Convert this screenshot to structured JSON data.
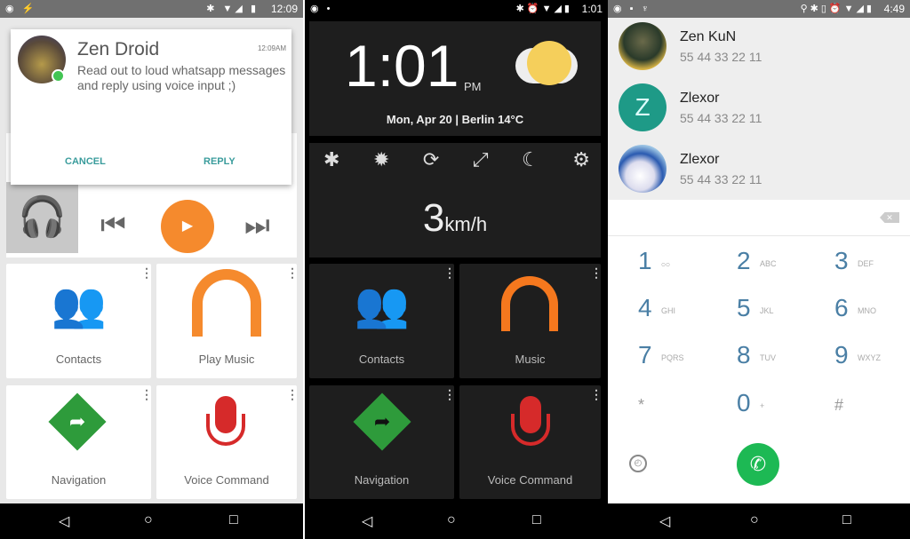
{
  "panel1": {
    "status": {
      "time": "12:09"
    },
    "notification": {
      "sender": "Zen Droid",
      "time": "12:09AM",
      "message": "Read out to loud whatsapp messages and reply using voice input ;)",
      "cancel": "CANCEL",
      "reply": "REPLY"
    },
    "tiles": [
      {
        "label": "Contacts",
        "icon": "contacts-icon"
      },
      {
        "label": "Play Music",
        "icon": "headphones-icon"
      },
      {
        "label": "Navigation",
        "icon": "navigation-icon"
      },
      {
        "label": "Voice Command",
        "icon": "microphone-icon"
      }
    ],
    "accent": "#f58a2d"
  },
  "panel2": {
    "status": {
      "time": "1:01"
    },
    "clock": {
      "time": "1:01",
      "ampm": "PM",
      "date": "Mon, Apr 20 | Berlin 14°C"
    },
    "quick_settings": [
      "bluetooth-icon",
      "auto-brightness-icon",
      "rotation-icon",
      "fullscreen-icon",
      "night-mode-icon",
      "settings-icon"
    ],
    "speed": {
      "value": "3",
      "unit": "km/h"
    },
    "tiles": [
      {
        "label": "Contacts"
      },
      {
        "label": "Music"
      },
      {
        "label": "Navigation"
      },
      {
        "label": "Voice Command"
      }
    ]
  },
  "panel3": {
    "status": {
      "time": "4:49"
    },
    "contacts": [
      {
        "name": "Zen KuN",
        "number": "55 44 33 22 11"
      },
      {
        "name": "Zlexor",
        "number": "55 44 33 22 11",
        "initial": "Z"
      },
      {
        "name": "Zlexor",
        "number": "55 44 33 22 11"
      }
    ],
    "keys": [
      {
        "d": "1",
        "l": "ဝဝ"
      },
      {
        "d": "2",
        "l": "ABC"
      },
      {
        "d": "3",
        "l": "DEF"
      },
      {
        "d": "4",
        "l": "GHI"
      },
      {
        "d": "5",
        "l": "JKL"
      },
      {
        "d": "6",
        "l": "MNO"
      },
      {
        "d": "7",
        "l": "PQRS"
      },
      {
        "d": "8",
        "l": "TUV"
      },
      {
        "d": "9",
        "l": "WXYZ"
      },
      {
        "d": "*",
        "l": ""
      },
      {
        "d": "0",
        "l": "+"
      },
      {
        "d": "#",
        "l": ""
      }
    ],
    "call_color": "#1db954",
    "avatar_color": "#1e9a87"
  }
}
